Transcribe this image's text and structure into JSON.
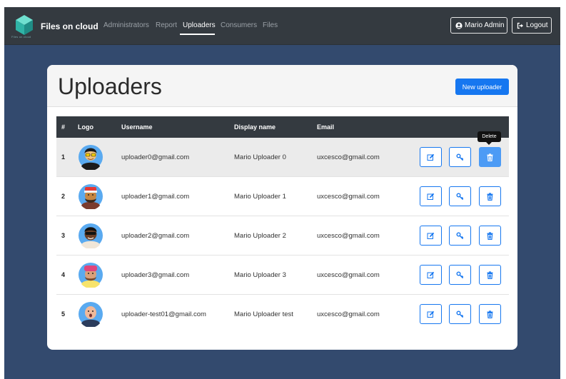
{
  "navbar": {
    "brand": "Files on cloud",
    "logo_caption": "Files on cloud",
    "links": [
      {
        "label": "Administrators",
        "active": false
      },
      {
        "label": "Report",
        "active": false
      },
      {
        "label": "Uploaders",
        "active": true
      },
      {
        "label": "Consumers",
        "active": false
      },
      {
        "label": "Files",
        "active": false
      }
    ],
    "user_label": "Mario Admin",
    "logout_label": "Logout"
  },
  "page": {
    "title": "Uploaders",
    "new_button_label": "New uploader"
  },
  "table": {
    "columns": [
      "#",
      "Logo",
      "Username",
      "Display name",
      "Email"
    ],
    "rows": [
      {
        "num": "1",
        "username": "uploader0@gmail.com",
        "display_name": "Mario Uploader 0",
        "email": "uxcesco@gmail.com"
      },
      {
        "num": "2",
        "username": "uploader1@gmail.com",
        "display_name": "Mario Uploader 1",
        "email": "uxcesco@gmail.com"
      },
      {
        "num": "3",
        "username": "uploader2@gmail.com",
        "display_name": "Mario Uploader 2",
        "email": "uxcesco@gmail.com"
      },
      {
        "num": "4",
        "username": "uploader3@gmail.com",
        "display_name": "Mario Uploader 3",
        "email": "uxcesco@gmail.com"
      },
      {
        "num": "5",
        "username": "uploader-test01@gmail.com",
        "display_name": "Mario Uploader test",
        "email": "uxcesco@gmail.com"
      }
    ],
    "row_actions": [
      "edit-icon",
      "key-icon",
      "trash-icon"
    ]
  },
  "tooltip": {
    "text": "Delete"
  },
  "colors": {
    "navbar": "#343a40",
    "page_background": "#334a6e",
    "primary": "#1677f0",
    "active_delete": "#4c9bf5",
    "avatar_background": "#5aaaf0"
  }
}
